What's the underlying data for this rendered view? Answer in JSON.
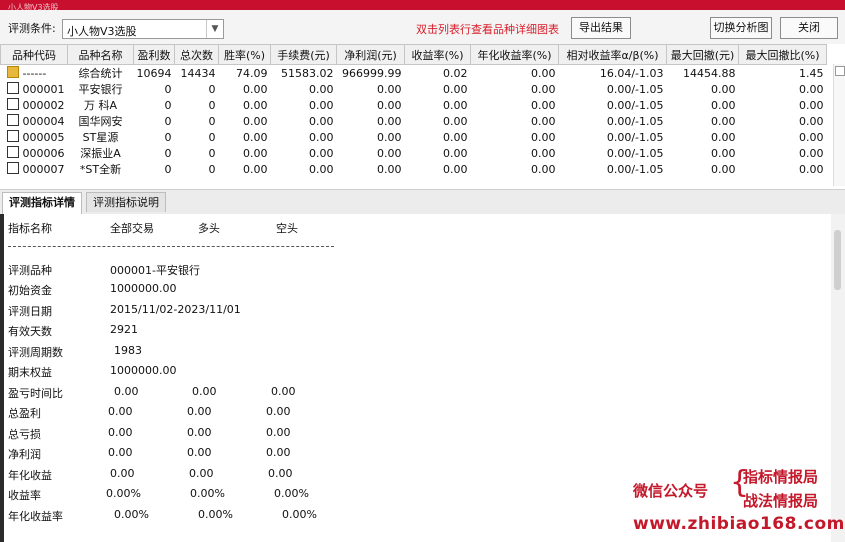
{
  "window": {
    "title": "小人物V3选股"
  },
  "toolbar": {
    "condition_label": "评测条件:",
    "condition_value": "小人物V3选股",
    "hint": "双击列表行查看品种详细图表",
    "export_label": "导出结果",
    "switch_label": "切换分析图",
    "close_label": "关闭"
  },
  "grid": {
    "columns": [
      "品种代码",
      "品种名称",
      "盈利数",
      "总次数",
      "胜率(%)",
      "手续费(元)",
      "净利润(元)",
      "收益率(%)",
      "年化收益率(%)",
      "相对收益率α/β(%)",
      "最大回撤(元)",
      "最大回撤比(%)"
    ],
    "rows": [
      [
        "------",
        "综合统计",
        "10694",
        "14434",
        "74.09",
        "51583.02",
        "966999.99",
        "0.02",
        "0.00",
        "16.04/-1.03",
        "14454.88",
        "1.45"
      ],
      [
        "000001",
        "平安银行",
        "0",
        "0",
        "0.00",
        "0.00",
        "0.00",
        "0.00",
        "0.00",
        "0.00/-1.05",
        "0.00",
        "0.00"
      ],
      [
        "000002",
        "万 科A",
        "0",
        "0",
        "0.00",
        "0.00",
        "0.00",
        "0.00",
        "0.00",
        "0.00/-1.05",
        "0.00",
        "0.00"
      ],
      [
        "000004",
        "国华网安",
        "0",
        "0",
        "0.00",
        "0.00",
        "0.00",
        "0.00",
        "0.00",
        "0.00/-1.05",
        "0.00",
        "0.00"
      ],
      [
        "000005",
        "ST星源",
        "0",
        "0",
        "0.00",
        "0.00",
        "0.00",
        "0.00",
        "0.00",
        "0.00/-1.05",
        "0.00",
        "0.00"
      ],
      [
        "000006",
        "深振业A",
        "0",
        "0",
        "0.00",
        "0.00",
        "0.00",
        "0.00",
        "0.00",
        "0.00/-1.05",
        "0.00",
        "0.00"
      ],
      [
        "000007",
        "*ST全新",
        "0",
        "0",
        "0.00",
        "0.00",
        "0.00",
        "0.00",
        "0.00",
        "0.00/-1.05",
        "0.00",
        "0.00"
      ]
    ]
  },
  "tabs": [
    "评测指标详情",
    "评测指标说明"
  ],
  "detail": {
    "headers": [
      "指标名称",
      "全部交易",
      "多头",
      "空头"
    ],
    "info": [
      {
        "label": "评测品种",
        "value": "000001-平安银行"
      },
      {
        "label": "初始资金",
        "value": "1000000.00"
      },
      {
        "label": "评测日期",
        "value": "2015/11/02-2023/11/01"
      },
      {
        "label": "有效天数",
        "value": "2921"
      },
      {
        "label": "评测周期数",
        "value": "1983"
      },
      {
        "label": "期末权益",
        "value": "1000000.00"
      }
    ],
    "metrics": [
      {
        "label": "盈亏时间比",
        "all": "0.00",
        "long": "0.00",
        "short": "0.00"
      },
      {
        "label": "总盈利",
        "all": "0.00",
        "long": "0.00",
        "short": "0.00"
      },
      {
        "label": "总亏损",
        "all": "0.00",
        "long": "0.00",
        "short": "0.00"
      },
      {
        "label": "净利润",
        "all": "0.00",
        "long": "0.00",
        "short": "0.00"
      },
      {
        "label": "年化收益",
        "all": "0.00",
        "long": "0.00",
        "short": "0.00"
      },
      {
        "label": "收益率",
        "all": "0.00%",
        "long": "0.00%",
        "short": "0.00%"
      },
      {
        "label": "年化收益率",
        "all": "0.00%",
        "long": "0.00%",
        "short": "0.00%"
      }
    ]
  },
  "watermark": {
    "line1": "微信公众号",
    "line2": "指标情报局",
    "line3": "战法情报局",
    "url": "www.zhibiao168.com"
  }
}
